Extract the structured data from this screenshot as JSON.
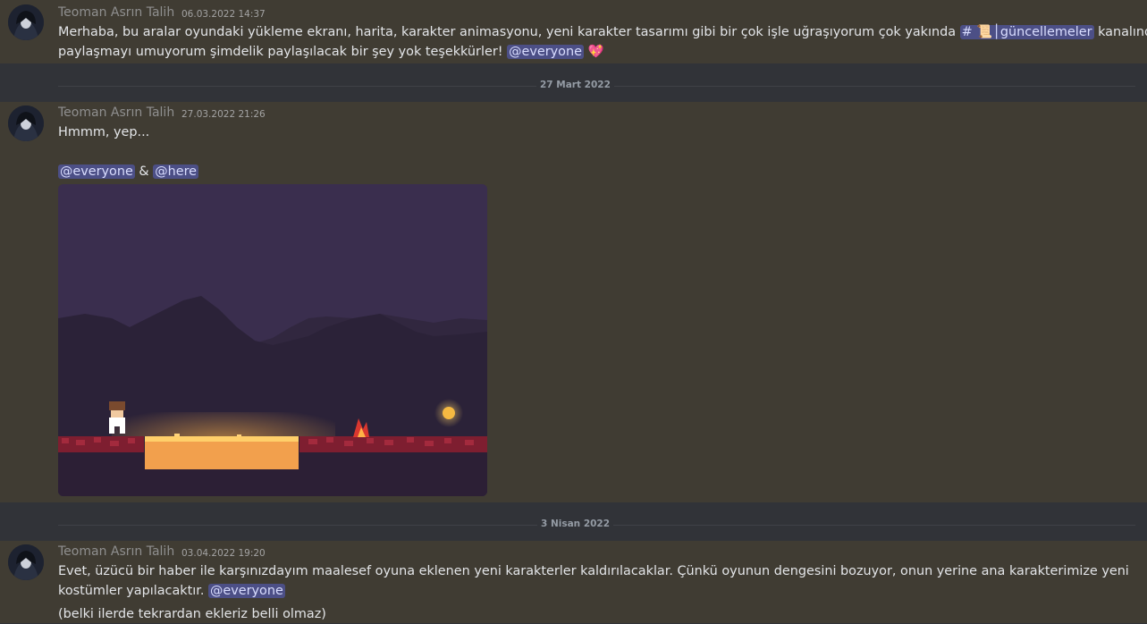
{
  "messages": [
    {
      "author": "Teoman Asrın Talih",
      "timestamp": "06.03.2022 14:37",
      "line1": "Merhaba, bu aralar oyundaki yükleme ekranı, harita, karakter animasyonu, yeni karakter tasarımı gibi bir çok işle uğraşıyorum çok yakında",
      "channel_hash": "#",
      "channel_emoji": "📜",
      "channel_name": "│güncellemeler",
      "line1_after": "kanalında",
      "line2": "paylaşmayı umuyorum şimdelik paylaşılacak bir şey yok teşekkürler!",
      "mention": "@everyone",
      "emoji": "💖"
    },
    {
      "author": "Teoman Asrın Talih",
      "timestamp": "27.03.2022 21:26",
      "line1": "Hmmm, yep...",
      "mention1": "@everyone",
      "amp": "&",
      "mention2": "@here"
    },
    {
      "author": "Teoman Asrın Talih",
      "timestamp": "03.04.2022 19:20",
      "line1": "Evet, üzücü bir haber ile karşınızdayım maalesef oyuna eklenen yeni karakterler kaldırılacaklar. Çünkü oyunun dengesini bozuyor, onun yerine ana karakterimize yeni",
      "line2": "kostümler yapılacaktır.",
      "mention": "@everyone",
      "followup": "(belki ilerde tekrardan ekleriz belli olmaz)"
    }
  ],
  "dividers": [
    "27 Mart 2022",
    "3 Nisan 2022"
  ],
  "colors": {
    "background": "#313338",
    "highlight": "#403c33",
    "mention_bg": "#4c4f86",
    "mention_text": "#d9ddff"
  }
}
